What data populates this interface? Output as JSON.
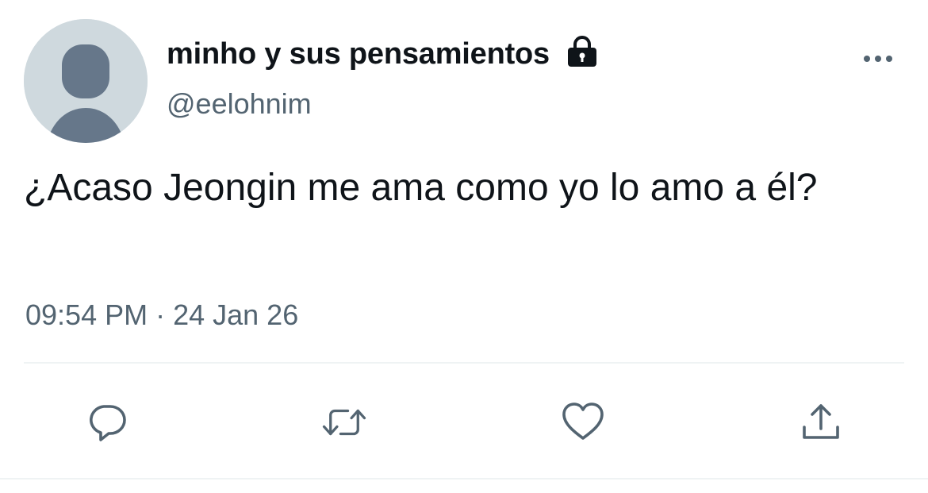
{
  "user": {
    "display_name": "minho y sus pensamientos",
    "handle": "@eelohnim",
    "protected_icon": "lock-icon",
    "avatar_icon": "default-avatar-icon"
  },
  "tweet": {
    "text": "¿Acaso Jeongin me ama como yo lo amo a él?",
    "timestamp": "09:54 PM · 24 Jan 26"
  },
  "actions": {
    "more_icon": "more-dots-icon",
    "reply_icon": "reply-icon",
    "retweet_icon": "retweet-icon",
    "like_icon": "heart-icon",
    "share_icon": "share-icon"
  },
  "colors": {
    "primary_text": "#0f1419",
    "secondary_text": "#536471",
    "avatar_bg": "#cfd9de",
    "avatar_fg": "#66778a",
    "divider": "#eff3f4",
    "icon": "#536471"
  }
}
